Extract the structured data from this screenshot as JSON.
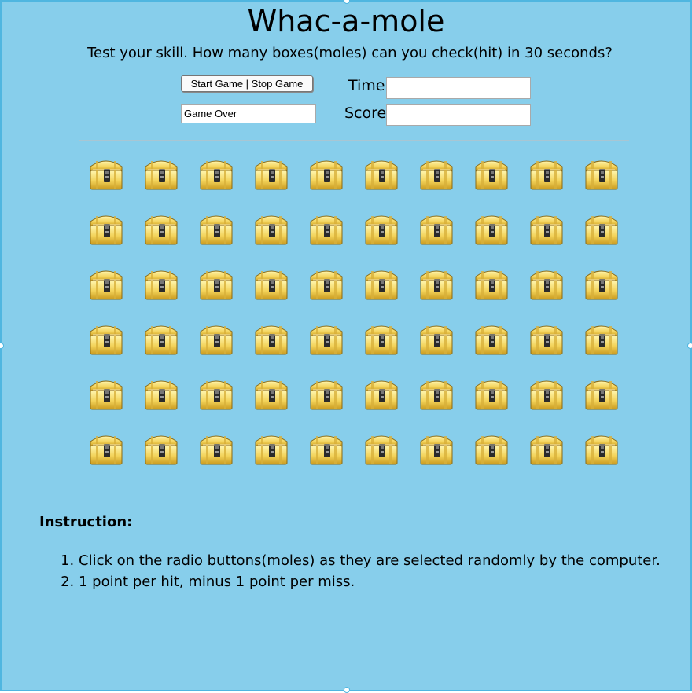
{
  "header": {
    "title": "Whac-a-mole",
    "subtitle": "Test your skill. How many boxes(moles) can you check(hit) in 30 seconds?"
  },
  "controls": {
    "start_stop_label": "Start Game | Stop Game",
    "status_value": "Game Over",
    "time_label": "Time:",
    "time_value": "",
    "score_label": "Score:",
    "score_value": ""
  },
  "board": {
    "rows": 6,
    "cols": 10,
    "mole_icon": "treasure-chest-icon"
  },
  "instructions": {
    "title": "Instruction:",
    "items": [
      "Click on the radio buttons(moles) as they are selected randomly by the computer.",
      "1 point per hit, minus 1 point per miss."
    ]
  },
  "colors": {
    "background": "#87ceeb",
    "frame_border": "#4fb6e0"
  }
}
